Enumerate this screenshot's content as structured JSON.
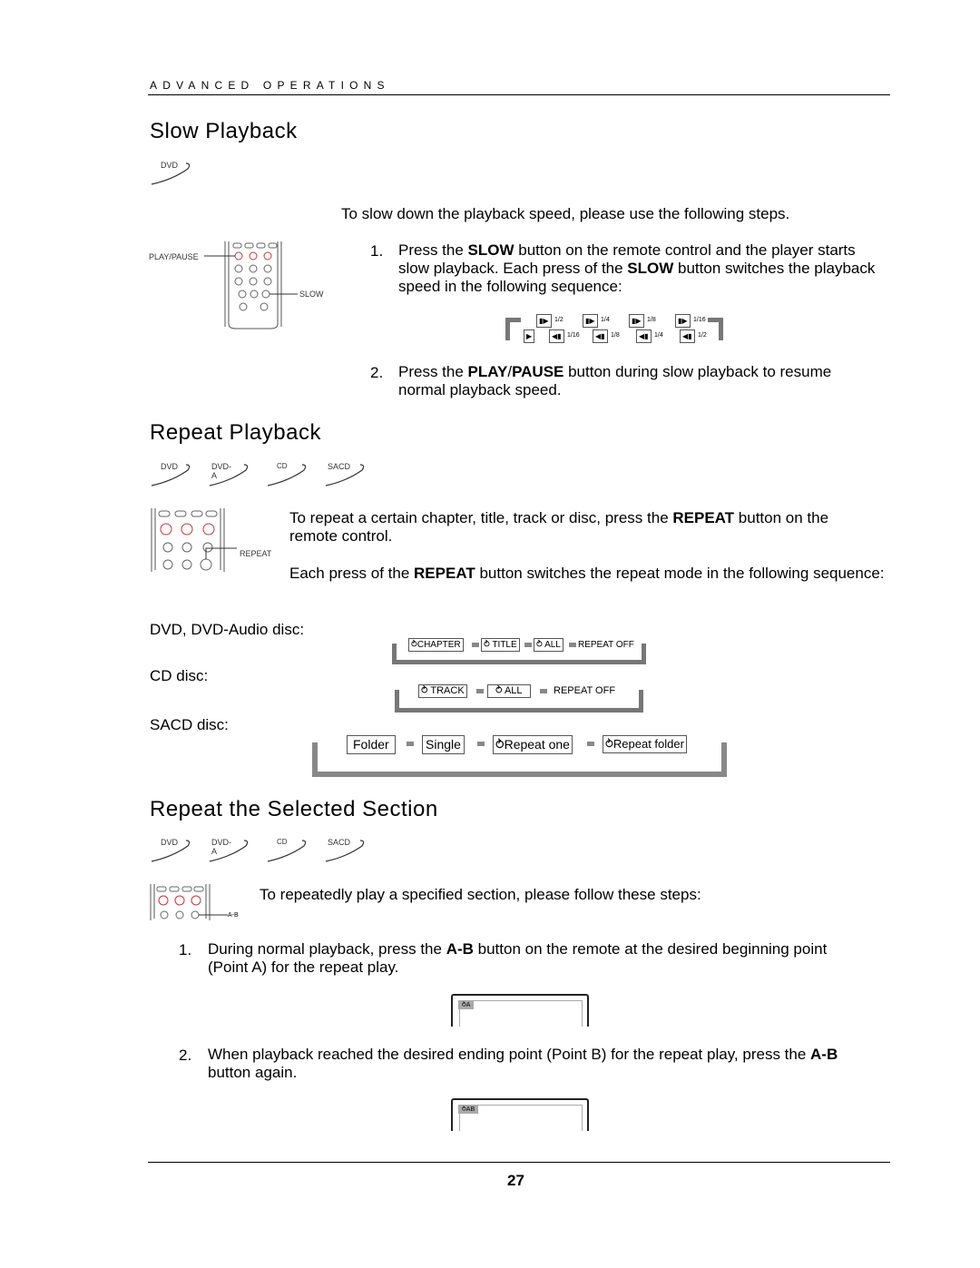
{
  "header": "ADVANCED OPERATIONS",
  "slow": {
    "title": "Slow Playback",
    "badges": [
      "DVD"
    ],
    "remote_labels": {
      "play": "PLAY/PAUSE",
      "slow": "SLOW"
    },
    "intro": "To slow down the playback speed, please use the following steps.",
    "step1_num": "1.",
    "step1": [
      "Press the ",
      "SLOW",
      " button on the remote control and the player starts slow playback.  Each press of the ",
      "SLOW",
      " button switches the playback speed in the following sequence:"
    ],
    "sequence_top": [
      "1/2",
      "1/4",
      "1/8",
      "1/16"
    ],
    "sequence_bottom": [
      "1/16",
      "1/8",
      "1/4",
      "1/2"
    ],
    "step2_num": "2.",
    "step2": [
      "Press the ",
      "PLAY",
      "/",
      "PAUSE",
      " button during slow playback to resume normal playback speed."
    ]
  },
  "repeat": {
    "title": "Repeat Playback",
    "badges": [
      "DVD",
      "DVD-A",
      "CD",
      "SACD"
    ],
    "remote_label": "REPEAT",
    "para1": [
      "To repeat a certain chapter, title, track or disc, press the ",
      "REPEAT",
      " button on the remote control."
    ],
    "para2": [
      "Each press of the ",
      "REPEAT",
      " button switches the repeat mode in the following sequence:"
    ],
    "dvd_label": "DVD, DVD-Audio disc:",
    "dvd_seq": [
      "CHAPTER",
      "TITLE",
      "ALL",
      "REPEAT OFF"
    ],
    "cd_label": "CD disc:",
    "cd_seq": [
      "TRACK",
      "ALL",
      "REPEAT OFF"
    ],
    "sacd_label": "SACD disc:",
    "sacd_seq": [
      "Folder",
      "Single",
      "Repeat one",
      "Repeat folder"
    ]
  },
  "ab": {
    "title": "Repeat the Selected Section",
    "badges": [
      "DVD",
      "DVD-A",
      "CD",
      "SACD"
    ],
    "remote_label": "A-B",
    "intro": "To repeatedly play a specified section, please follow these steps:",
    "step1_num": "1.",
    "step1": [
      "During normal playback, press the ",
      "A-B",
      " button on the remote at the desired beginning point (Point A) for the repeat play."
    ],
    "screen1": "A",
    "step2_num": "2.",
    "step2": [
      "When playback reached the desired ending point (Point B) for the repeat play, press the ",
      "A-B",
      " button again."
    ],
    "screen2": "AB"
  },
  "page_number": "27"
}
